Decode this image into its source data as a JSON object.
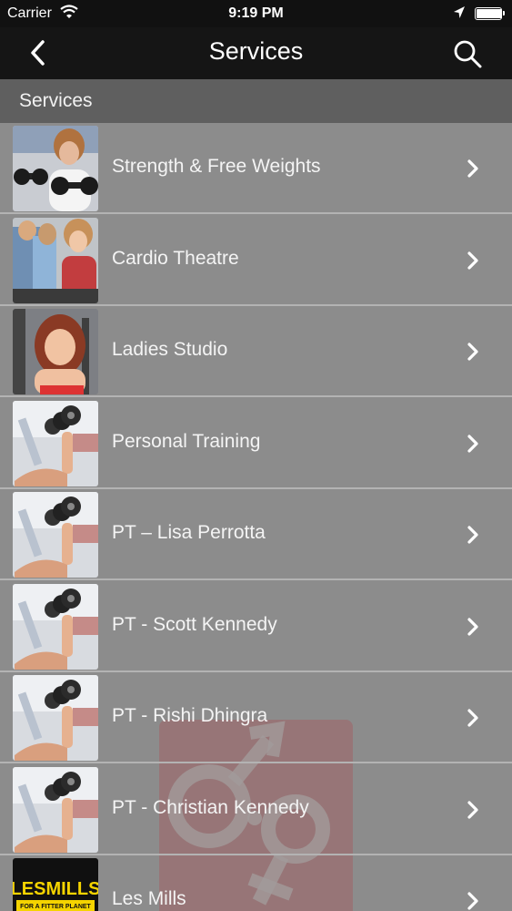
{
  "status": {
    "carrier": "Carrier",
    "time": "9:19 PM",
    "battery_level": 1.0
  },
  "nav": {
    "title": "Services",
    "back_icon": "chevron-left-icon",
    "search_icon": "search-icon"
  },
  "section": {
    "title": "Services"
  },
  "items": [
    {
      "label": "Strength & Free Weights",
      "thumb": "strength-photo"
    },
    {
      "label": "Cardio Theatre",
      "thumb": "cardio-photo"
    },
    {
      "label": "Ladies Studio",
      "thumb": "ladies-studio-photo"
    },
    {
      "label": "Personal Training",
      "thumb": "dumbbell-photo"
    },
    {
      "label": "PT – Lisa Perrotta",
      "thumb": "dumbbell-photo"
    },
    {
      "label": "PT - Scott Kennedy",
      "thumb": "dumbbell-photo"
    },
    {
      "label": "PT - Rishi Dhingra",
      "thumb": "dumbbell-photo"
    },
    {
      "label": "PT - Christian Kennedy",
      "thumb": "dumbbell-photo"
    },
    {
      "label": "Les Mills",
      "thumb": "les-mills-logo",
      "logo_text": "LESMILLS",
      "logo_subtext": "FOR A FITTER PLANET"
    }
  ],
  "colors": {
    "nav_bg": "#151515",
    "section_bg": "#5f5f5f",
    "list_bg": "#8c8c8c",
    "separator": "#b3b3b3",
    "watermark": "#9b6e70"
  }
}
